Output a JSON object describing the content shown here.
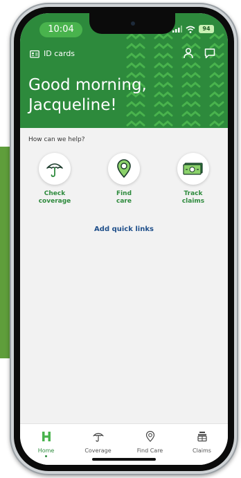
{
  "status_bar": {
    "time": "10:04",
    "battery": "94"
  },
  "header": {
    "id_cards_label": "ID cards",
    "greeting_line1": "Good morning,",
    "greeting_line2": "Jacqueline!"
  },
  "main": {
    "help_prompt": "How can we help?",
    "quick_actions": [
      {
        "label": "Check\ncoverage",
        "icon": "umbrella-icon"
      },
      {
        "label": "Find\ncare",
        "icon": "location-pin-icon"
      },
      {
        "label": "Track\nclaims",
        "icon": "cash-icon"
      }
    ],
    "add_quick_links": "Add quick links"
  },
  "tabbar": {
    "tabs": [
      {
        "label": "Home",
        "icon": "home-h-icon",
        "active": true
      },
      {
        "label": "Coverage",
        "icon": "umbrella-icon"
      },
      {
        "label": "Find Care",
        "icon": "location-pin-icon"
      },
      {
        "label": "Claims",
        "icon": "claims-register-icon"
      }
    ]
  },
  "colors": {
    "brand_green": "#2d8a3c",
    "accent_lime": "#49b34d",
    "link_blue": "#1f4f8a"
  }
}
